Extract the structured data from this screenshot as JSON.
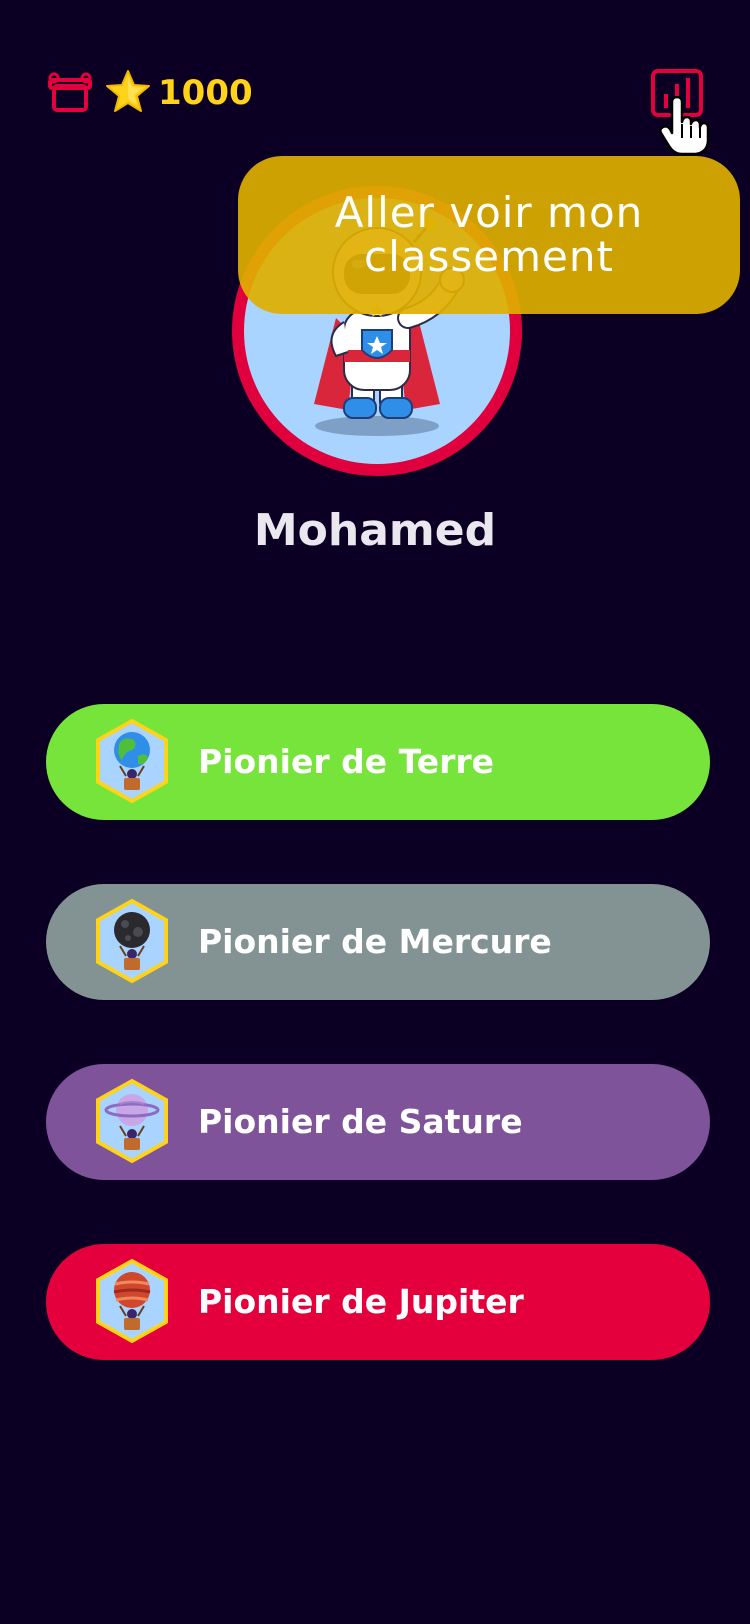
{
  "header": {
    "points": "1000",
    "icons": {
      "gift": "gift-icon",
      "star": "star-icon",
      "leaderboard": "leaderboard-icon",
      "cursor": "hand-pointer-icon"
    }
  },
  "tooltip": {
    "text": "Aller voir mon\nclassement"
  },
  "profile": {
    "name": "Mohamed"
  },
  "pioneers": [
    {
      "label": "Pionier de Terre",
      "color": "#76e43a",
      "planet": "earth"
    },
    {
      "label": "Pionier de Mercure",
      "color": "#839393",
      "planet": "mercury"
    },
    {
      "label": "Pionier de Sature",
      "color": "#7e5399",
      "planet": "saturn"
    },
    {
      "label": "Pionier de Jupiter",
      "color": "#e4003c",
      "planet": "jupiter"
    }
  ],
  "colors": {
    "background": "#0b0024",
    "accent_red": "#e4003c",
    "gold": "#ffd319",
    "tooltip": "#e0af00"
  }
}
